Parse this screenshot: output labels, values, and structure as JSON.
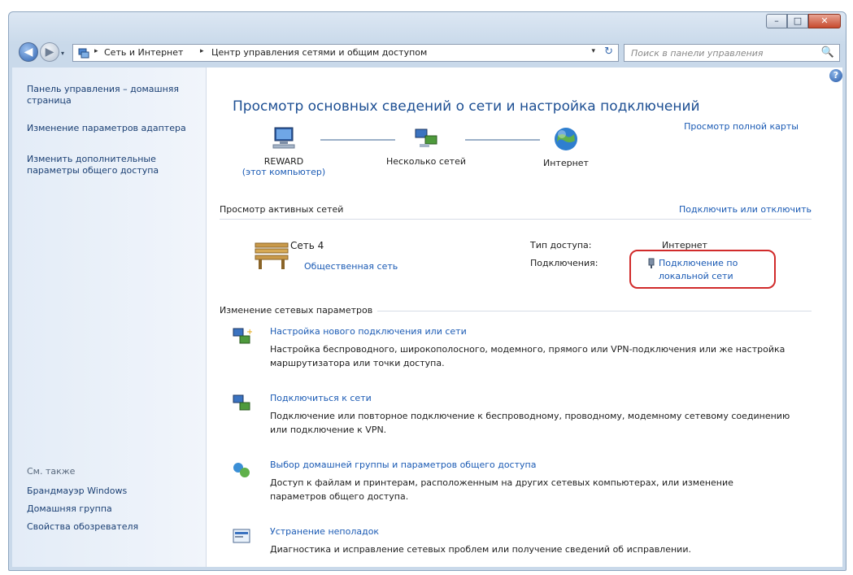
{
  "window": {
    "controls": {
      "minimize": "–",
      "maximize": "□",
      "close": "✕"
    }
  },
  "address_bar": {
    "crumbs": [
      "Сеть и Интернет",
      "Центр управления сетями и общим доступом"
    ],
    "history_dropdown": "▾",
    "separator": "▸",
    "dropdown_arrow": "▾",
    "refresh_symbol": "↻"
  },
  "search": {
    "placeholder": "Поиск в панели управления",
    "icon": "🔍"
  },
  "sidebar": {
    "home": "Панель управления – домашняя страница",
    "links": [
      "Изменение параметров адаптера",
      "Изменить дополнительные параметры общего доступа"
    ],
    "see_also_title": "См. также",
    "see_also": [
      "Брандмауэр Windows",
      "Домашняя группа",
      "Свойства обозревателя"
    ]
  },
  "main": {
    "title": "Просмотр основных сведений о сети и настройка подключений",
    "full_map_link": "Просмотр полной карты",
    "help_icon": "?",
    "network_map": {
      "computer": {
        "name": "REWARD",
        "sub": "(этот компьютер)"
      },
      "middle": {
        "name": "Несколько сетей"
      },
      "internet": {
        "name": "Интернет"
      }
    },
    "active_header": "Просмотр активных сетей",
    "connect_disconnect": "Подключить или отключить",
    "active_network": {
      "name": "Сеть 4",
      "type_link": "Общественная сеть",
      "access_type_label": "Тип доступа:",
      "access_type_value": "Интернет",
      "connections_label": "Подключения:",
      "connections_value_line1": "Подключение по",
      "connections_value_line2": "локальной сети"
    },
    "change_settings_header": "Изменение сетевых параметров",
    "tasks": [
      {
        "title": "Настройка нового подключения или сети",
        "desc": "Настройка беспроводного, широкополосного, модемного, прямого или VPN-подключения или же настройка маршрутизатора или точки доступа."
      },
      {
        "title": "Подключиться к сети",
        "desc": "Подключение или повторное подключение к беспроводному, проводному, модемному сетевому соединению или подключение к VPN."
      },
      {
        "title": "Выбор домашней группы и параметров общего доступа",
        "desc": "Доступ к файлам и принтерам, расположенным на других сетевых компьютерах, или изменение параметров общего доступа."
      },
      {
        "title": "Устранение неполадок",
        "desc": "Диагностика и исправление сетевых проблем или получение сведений об исправлении."
      }
    ]
  }
}
